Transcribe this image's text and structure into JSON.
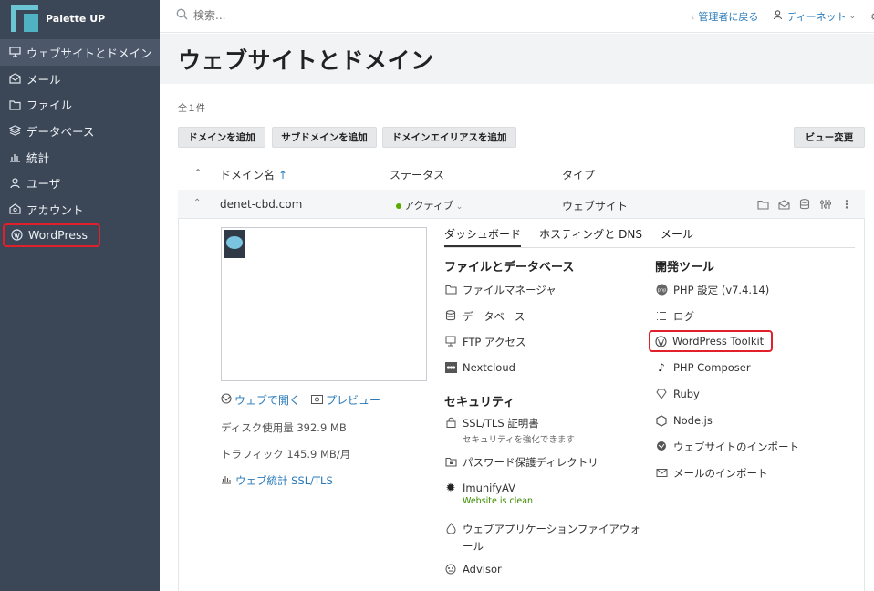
{
  "app": {
    "name": "Palette UP"
  },
  "search": {
    "placeholder": "検索..."
  },
  "header": {
    "back_admin": "管理者に戻る",
    "user": "ディーネット"
  },
  "sidebar": {
    "items": [
      {
        "label": "ウェブサイトとドメイン",
        "icon": "monitor-icon"
      },
      {
        "label": "メール",
        "icon": "mail-icon"
      },
      {
        "label": "ファイル",
        "icon": "folder-icon"
      },
      {
        "label": "データベース",
        "icon": "database-icon"
      },
      {
        "label": "統計",
        "icon": "chart-icon"
      },
      {
        "label": "ユーザ",
        "icon": "user-icon"
      },
      {
        "label": "アカウント",
        "icon": "account-icon"
      },
      {
        "label": "WordPress",
        "icon": "wordpress-icon"
      }
    ]
  },
  "page": {
    "title": "ウェブサイトとドメイン",
    "count": "全１件"
  },
  "toolbar": {
    "add_domain": "ドメインを追加",
    "add_subdomain": "サブドメインを追加",
    "add_alias": "ドメインエイリアスを追加",
    "change_view": "ビュー変更"
  },
  "table": {
    "headers": {
      "domain": "ドメイン名",
      "status": "ステータス",
      "type": "タイプ"
    },
    "row": {
      "domain": "denet-cbd.com",
      "status": "アクティブ",
      "type": "ウェブサイト"
    }
  },
  "details": {
    "open_web": "ウェブで開く",
    "preview": "プレビュー",
    "disk": "ディスク使用量 392.9 MB",
    "traffic": "トラフィック 145.9 MB/月",
    "stats_link": "ウェブ統計 SSL/TLS",
    "tabs": [
      "ダッシュボード",
      "ホスティングと DNS",
      "メール"
    ],
    "files_title": "ファイルとデータベース",
    "files": [
      "ファイルマネージャ",
      "データベース",
      "FTP アクセス",
      "Nextcloud"
    ],
    "security_title": "セキュリティ",
    "security": {
      "ssl": "SSL/TLS 証明書",
      "ssl_sub": "セキュリティを強化できます",
      "password_dir": "パスワード保護ディレクトリ",
      "imunify": "ImunifyAV",
      "imunify_sub": "Website is clean",
      "waf_line1": "ウェブアプリケーションファイアウォ",
      "waf_line2": "ール",
      "advisor": "Advisor"
    },
    "dev_title": "開発ツール",
    "dev": [
      "PHP 設定 (v7.4.14)",
      "ログ",
      "WordPress Toolkit",
      "PHP Composer",
      "Ruby",
      "Node.js",
      "ウェブサイトのインポート",
      "メールのインポート"
    ]
  },
  "colors": {
    "sidebar_bg": "#3b4656",
    "link": "#2a7ab8",
    "highlight": "#e0212b",
    "status_green": "#5aa800"
  }
}
